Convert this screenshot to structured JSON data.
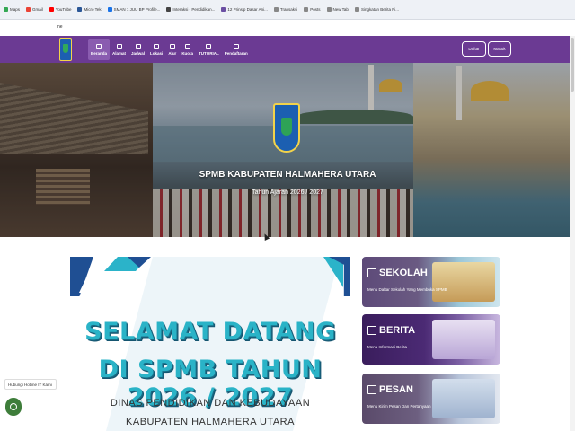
{
  "browser": {
    "bookmarks": [
      {
        "label": "Maps",
        "color": "#34a853"
      },
      {
        "label": "Gmail",
        "color": "#ea4335"
      },
      {
        "label": "YouTube",
        "color": "#ff0000"
      },
      {
        "label": "Micro Tek",
        "color": "#2b5797"
      },
      {
        "label": "SMAN 1 JUU BP Profile...",
        "color": "#1a73e8"
      },
      {
        "label": "Interaksi - Pendidikan...",
        "color": "#444444"
      },
      {
        "label": "12 Prinsip Dasar Ani...",
        "color": "#6b4fa3"
      },
      {
        "label": "Transaksi",
        "color": "#888888"
      },
      {
        "label": "Posts",
        "color": "#888888"
      },
      {
        "label": "New Tab",
        "color": "#888888"
      },
      {
        "label": "Singkatan Berita Pi...",
        "color": "#888888"
      }
    ],
    "address": "ne"
  },
  "nav": {
    "menu": [
      {
        "label": "Beranda",
        "active": true
      },
      {
        "label": "Alamat",
        "active": false
      },
      {
        "label": "Jadwal",
        "active": false
      },
      {
        "label": "Lokasi",
        "active": false
      },
      {
        "label": "Alur",
        "active": false
      },
      {
        "label": "Kuota",
        "active": false
      },
      {
        "label": "TUTORIAL",
        "active": false
      },
      {
        "label": "Pendaftaran",
        "active": false
      }
    ],
    "daftar": "Daftar",
    "masuk": "Masuk",
    "brand_color": "#6b3a93"
  },
  "hero": {
    "title": "SPMB KABUPATEN HALMAHERA UTARA",
    "subtitle": "Tahun Ajaran 2026 / 2027"
  },
  "banner": {
    "title1": "SELAMAT DATANG",
    "title2": "DI SPMB TAHUN 2026 / 2027",
    "line1": "DINAS PENDIDIKAN DAN KEBUDAYAAN",
    "line2": "KABUPATEN HALMAHERA UTARA"
  },
  "cards": {
    "sekolah": {
      "title": "SEKOLAH",
      "desc": "Menu Daftar Sekolah Yang Membuka SPMB"
    },
    "berita": {
      "title": "BERITA",
      "desc": "Menu Informasi Berita"
    },
    "pesan": {
      "title": "PESAN",
      "desc": "Menu Kirim Pesan Dan Pertanyaan"
    }
  },
  "hotline": "Hubungi Hotline IT Kami"
}
